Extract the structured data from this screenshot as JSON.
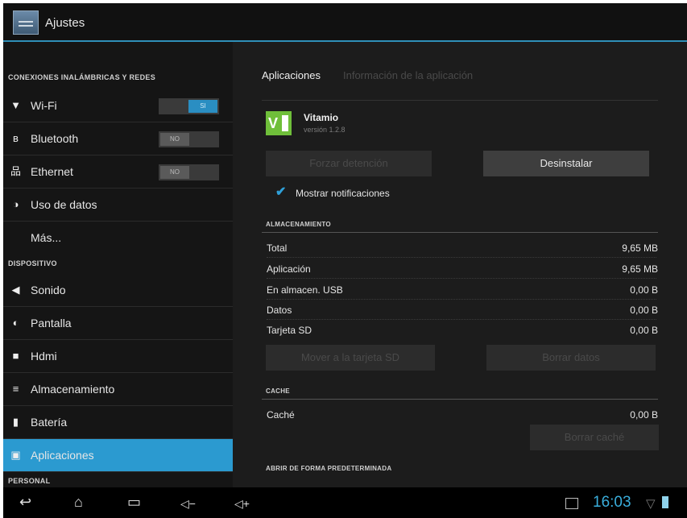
{
  "titlebar": {
    "title": "Ajustes"
  },
  "sidebar": {
    "section_wireless": "CONEXIONES INALÁMBRICAS Y REDES",
    "section_device": "DISPOSITIVO",
    "section_personal": "PERSONAL",
    "items": {
      "wifi": {
        "label": "Wi-Fi",
        "toggle": "SI"
      },
      "bluetooth": {
        "label": "Bluetooth",
        "toggle": "NO"
      },
      "ethernet": {
        "label": "Ethernet",
        "toggle": "NO"
      },
      "data": {
        "label": "Uso de datos"
      },
      "more": {
        "label": "Más..."
      },
      "sound": {
        "label": "Sonido"
      },
      "display": {
        "label": "Pantalla"
      },
      "hdmi": {
        "label": "Hdmi"
      },
      "storage": {
        "label": "Almacenamiento"
      },
      "battery": {
        "label": "Batería"
      },
      "apps": {
        "label": "Aplicaciones"
      }
    }
  },
  "main": {
    "tab_active": "Aplicaciones",
    "tab_inactive": "Información de la aplicación",
    "app": {
      "name": "Vitamio",
      "version": "versión 1.2.8",
      "icon_letter": "V"
    },
    "force_stop": "Forzar detención",
    "uninstall": "Desinstalar",
    "show_notifications": "Mostrar notificaciones",
    "storage_section": "ALMACENAMIENTO",
    "storage_rows": [
      {
        "label": "Total",
        "value": "9,65 MB"
      },
      {
        "label": "Aplicación",
        "value": "9,65 MB"
      },
      {
        "label": "En almacen. USB",
        "value": "0,00 B"
      },
      {
        "label": "Datos",
        "value": "0,00 B"
      },
      {
        "label": "Tarjeta SD",
        "value": "0,00 B"
      }
    ],
    "move_sd": "Mover a la tarjeta SD",
    "clear_data": "Borrar datos",
    "cache_section": "CACHE",
    "cache_label": "Caché",
    "cache_value": "0,00 B",
    "clear_cache": "Borrar caché",
    "default_section": "ABRIR DE FORMA PREDETERMINADA"
  },
  "navbar": {
    "clock": "16:03"
  }
}
